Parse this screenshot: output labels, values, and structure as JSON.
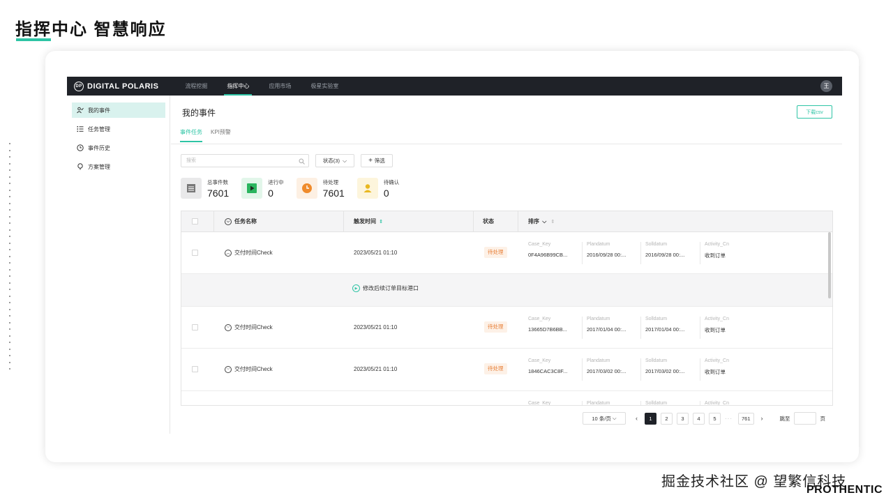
{
  "slide": {
    "title": "指挥中心 智慧响应",
    "watermark": "掘金技术社区 @ 望繁信科技",
    "brand": "PROTHENTIC"
  },
  "topbar": {
    "logo_mark": "DP",
    "logo_text": "DIGITAL POLARIS",
    "nav": [
      "流程挖掘",
      "指挥中心",
      "应用市场",
      "极星实验室"
    ],
    "active_nav": "指挥中心",
    "avatar": "王"
  },
  "sidebar": {
    "items": [
      {
        "label": "我的事件",
        "icon": "user-task-icon",
        "active": true
      },
      {
        "label": "任务管理",
        "icon": "list-icon",
        "active": false
      },
      {
        "label": "事件历史",
        "icon": "clock-icon",
        "active": false
      },
      {
        "label": "方案管理",
        "icon": "bulb-icon",
        "active": false
      }
    ]
  },
  "main": {
    "title": "我的事件",
    "download_label": "下载csv",
    "tabs": [
      {
        "label": "事件任务",
        "active": true
      },
      {
        "label": "KPI预警",
        "active": false
      }
    ],
    "search_placeholder": "搜索",
    "status_filter": "状态(3)",
    "filter_label": "筛选"
  },
  "stats": [
    {
      "label": "总事件数",
      "value": "7601",
      "icon": "document-icon",
      "color": "#e9e9ea"
    },
    {
      "label": "进行中",
      "value": "0",
      "icon": "play-icon",
      "color": "#e2f6ea"
    },
    {
      "label": "待处理",
      "value": "7601",
      "icon": "clock-icon",
      "color": "#fdf0e3"
    },
    {
      "label": "待确认",
      "value": "0",
      "icon": "user-icon",
      "color": "#fdf5dc"
    }
  ],
  "table": {
    "headers": {
      "name": "任务名称",
      "time": "触发时间",
      "status": "状态",
      "sort": "排序"
    },
    "rows": [
      {
        "name": "交付时间Check",
        "time": "2023/05/21 01:10",
        "status": "待处理",
        "expanded": true,
        "fields": [
          {
            "key": "Case_Key",
            "value": "0F4A96B99CB..."
          },
          {
            "key": "Plandatum",
            "value": "2016/09/28 00:..."
          },
          {
            "key": "Solldatum",
            "value": "2016/09/28 00:..."
          },
          {
            "key": "Activity_Cn",
            "value": "收到订单"
          }
        ]
      },
      {
        "name": "交付时间Check",
        "time": "2023/05/21 01:10",
        "status": "待处理",
        "expanded": false,
        "fields": [
          {
            "key": "Case_Key",
            "value": "13665D7B6BB..."
          },
          {
            "key": "Plandatum",
            "value": "2017/01/04 00:..."
          },
          {
            "key": "Solldatum",
            "value": "2017/01/04 00:..."
          },
          {
            "key": "Activity_Cn",
            "value": "收到订单"
          }
        ]
      },
      {
        "name": "交付时间Check",
        "time": "2023/05/21 01:10",
        "status": "待处理",
        "expanded": false,
        "fields": [
          {
            "key": "Case_Key",
            "value": "1846CAC3C8F..."
          },
          {
            "key": "Plandatum",
            "value": "2017/03/02 00:..."
          },
          {
            "key": "Solldatum",
            "value": "2017/03/02 00:..."
          },
          {
            "key": "Activity_Cn",
            "value": "收到订单"
          }
        ]
      }
    ],
    "partial_row": [
      "Case_Key",
      "Plandatum",
      "Solldatum",
      "Activity_Cn"
    ],
    "expanded_action": "修改后续订单目标港口"
  },
  "pagination": {
    "page_size": "10 条/页",
    "pages": [
      "1",
      "2",
      "3",
      "4",
      "5"
    ],
    "ellipsis": "···",
    "last_page": "761",
    "current": "1",
    "jump_label": "跳至",
    "page_suffix": "页"
  },
  "colors": {
    "accent": "#2ec4a5",
    "topbar": "#1f2228",
    "pending": "#e8813a"
  }
}
